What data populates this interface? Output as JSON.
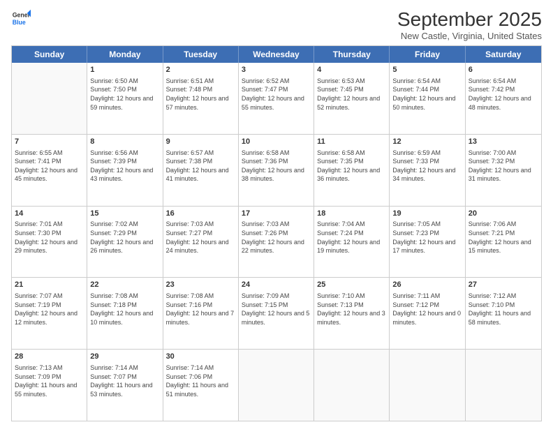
{
  "header": {
    "logo_line1": "General",
    "logo_line2": "Blue",
    "month_title": "September 2025",
    "location": "New Castle, Virginia, United States"
  },
  "weekdays": [
    "Sunday",
    "Monday",
    "Tuesday",
    "Wednesday",
    "Thursday",
    "Friday",
    "Saturday"
  ],
  "rows": [
    [
      {
        "day": "",
        "info": ""
      },
      {
        "day": "1",
        "info": "Sunrise: 6:50 AM\nSunset: 7:50 PM\nDaylight: 12 hours\nand 59 minutes."
      },
      {
        "day": "2",
        "info": "Sunrise: 6:51 AM\nSunset: 7:48 PM\nDaylight: 12 hours\nand 57 minutes."
      },
      {
        "day": "3",
        "info": "Sunrise: 6:52 AM\nSunset: 7:47 PM\nDaylight: 12 hours\nand 55 minutes."
      },
      {
        "day": "4",
        "info": "Sunrise: 6:53 AM\nSunset: 7:45 PM\nDaylight: 12 hours\nand 52 minutes."
      },
      {
        "day": "5",
        "info": "Sunrise: 6:54 AM\nSunset: 7:44 PM\nDaylight: 12 hours\nand 50 minutes."
      },
      {
        "day": "6",
        "info": "Sunrise: 6:54 AM\nSunset: 7:42 PM\nDaylight: 12 hours\nand 48 minutes."
      }
    ],
    [
      {
        "day": "7",
        "info": "Sunrise: 6:55 AM\nSunset: 7:41 PM\nDaylight: 12 hours\nand 45 minutes."
      },
      {
        "day": "8",
        "info": "Sunrise: 6:56 AM\nSunset: 7:39 PM\nDaylight: 12 hours\nand 43 minutes."
      },
      {
        "day": "9",
        "info": "Sunrise: 6:57 AM\nSunset: 7:38 PM\nDaylight: 12 hours\nand 41 minutes."
      },
      {
        "day": "10",
        "info": "Sunrise: 6:58 AM\nSunset: 7:36 PM\nDaylight: 12 hours\nand 38 minutes."
      },
      {
        "day": "11",
        "info": "Sunrise: 6:58 AM\nSunset: 7:35 PM\nDaylight: 12 hours\nand 36 minutes."
      },
      {
        "day": "12",
        "info": "Sunrise: 6:59 AM\nSunset: 7:33 PM\nDaylight: 12 hours\nand 34 minutes."
      },
      {
        "day": "13",
        "info": "Sunrise: 7:00 AM\nSunset: 7:32 PM\nDaylight: 12 hours\nand 31 minutes."
      }
    ],
    [
      {
        "day": "14",
        "info": "Sunrise: 7:01 AM\nSunset: 7:30 PM\nDaylight: 12 hours\nand 29 minutes."
      },
      {
        "day": "15",
        "info": "Sunrise: 7:02 AM\nSunset: 7:29 PM\nDaylight: 12 hours\nand 26 minutes."
      },
      {
        "day": "16",
        "info": "Sunrise: 7:03 AM\nSunset: 7:27 PM\nDaylight: 12 hours\nand 24 minutes."
      },
      {
        "day": "17",
        "info": "Sunrise: 7:03 AM\nSunset: 7:26 PM\nDaylight: 12 hours\nand 22 minutes."
      },
      {
        "day": "18",
        "info": "Sunrise: 7:04 AM\nSunset: 7:24 PM\nDaylight: 12 hours\nand 19 minutes."
      },
      {
        "day": "19",
        "info": "Sunrise: 7:05 AM\nSunset: 7:23 PM\nDaylight: 12 hours\nand 17 minutes."
      },
      {
        "day": "20",
        "info": "Sunrise: 7:06 AM\nSunset: 7:21 PM\nDaylight: 12 hours\nand 15 minutes."
      }
    ],
    [
      {
        "day": "21",
        "info": "Sunrise: 7:07 AM\nSunset: 7:19 PM\nDaylight: 12 hours\nand 12 minutes."
      },
      {
        "day": "22",
        "info": "Sunrise: 7:08 AM\nSunset: 7:18 PM\nDaylight: 12 hours\nand 10 minutes."
      },
      {
        "day": "23",
        "info": "Sunrise: 7:08 AM\nSunset: 7:16 PM\nDaylight: 12 hours\nand 7 minutes."
      },
      {
        "day": "24",
        "info": "Sunrise: 7:09 AM\nSunset: 7:15 PM\nDaylight: 12 hours\nand 5 minutes."
      },
      {
        "day": "25",
        "info": "Sunrise: 7:10 AM\nSunset: 7:13 PM\nDaylight: 12 hours\nand 3 minutes."
      },
      {
        "day": "26",
        "info": "Sunrise: 7:11 AM\nSunset: 7:12 PM\nDaylight: 12 hours\nand 0 minutes."
      },
      {
        "day": "27",
        "info": "Sunrise: 7:12 AM\nSunset: 7:10 PM\nDaylight: 11 hours\nand 58 minutes."
      }
    ],
    [
      {
        "day": "28",
        "info": "Sunrise: 7:13 AM\nSunset: 7:09 PM\nDaylight: 11 hours\nand 55 minutes."
      },
      {
        "day": "29",
        "info": "Sunrise: 7:14 AM\nSunset: 7:07 PM\nDaylight: 11 hours\nand 53 minutes."
      },
      {
        "day": "30",
        "info": "Sunrise: 7:14 AM\nSunset: 7:06 PM\nDaylight: 11 hours\nand 51 minutes."
      },
      {
        "day": "",
        "info": ""
      },
      {
        "day": "",
        "info": ""
      },
      {
        "day": "",
        "info": ""
      },
      {
        "day": "",
        "info": ""
      }
    ]
  ]
}
